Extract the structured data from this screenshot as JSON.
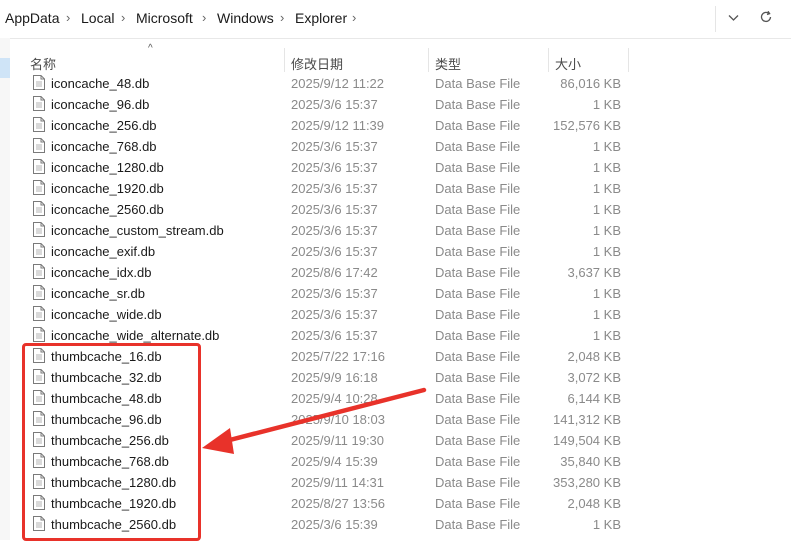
{
  "breadcrumb": [
    "AppData",
    "Local",
    "Microsoft",
    "Windows",
    "Explorer"
  ],
  "address_buttons": {
    "expand_icon": "chevron-down-icon",
    "refresh_icon": "refresh-icon"
  },
  "columns": {
    "name": "名称",
    "date": "修改日期",
    "type": "类型",
    "size": "大小"
  },
  "sort_indicator": "^",
  "files": [
    {
      "name": "iconcache_48.db",
      "date": "2025/9/12 11:22",
      "type": "Data Base File",
      "size": "86,016 KB"
    },
    {
      "name": "iconcache_96.db",
      "date": "2025/3/6 15:37",
      "type": "Data Base File",
      "size": "1 KB"
    },
    {
      "name": "iconcache_256.db",
      "date": "2025/9/12 11:39",
      "type": "Data Base File",
      "size": "152,576 KB"
    },
    {
      "name": "iconcache_768.db",
      "date": "2025/3/6 15:37",
      "type": "Data Base File",
      "size": "1 KB"
    },
    {
      "name": "iconcache_1280.db",
      "date": "2025/3/6 15:37",
      "type": "Data Base File",
      "size": "1 KB"
    },
    {
      "name": "iconcache_1920.db",
      "date": "2025/3/6 15:37",
      "type": "Data Base File",
      "size": "1 KB"
    },
    {
      "name": "iconcache_2560.db",
      "date": "2025/3/6 15:37",
      "type": "Data Base File",
      "size": "1 KB"
    },
    {
      "name": "iconcache_custom_stream.db",
      "date": "2025/3/6 15:37",
      "type": "Data Base File",
      "size": "1 KB"
    },
    {
      "name": "iconcache_exif.db",
      "date": "2025/3/6 15:37",
      "type": "Data Base File",
      "size": "1 KB"
    },
    {
      "name": "iconcache_idx.db",
      "date": "2025/8/6 17:42",
      "type": "Data Base File",
      "size": "3,637 KB"
    },
    {
      "name": "iconcache_sr.db",
      "date": "2025/3/6 15:37",
      "type": "Data Base File",
      "size": "1 KB"
    },
    {
      "name": "iconcache_wide.db",
      "date": "2025/3/6 15:37",
      "type": "Data Base File",
      "size": "1 KB"
    },
    {
      "name": "iconcache_wide_alternate.db",
      "date": "2025/3/6 15:37",
      "type": "Data Base File",
      "size": "1 KB"
    },
    {
      "name": "thumbcache_16.db",
      "date": "2025/7/22 17:16",
      "type": "Data Base File",
      "size": "2,048 KB"
    },
    {
      "name": "thumbcache_32.db",
      "date": "2025/9/9 16:18",
      "type": "Data Base File",
      "size": "3,072 KB"
    },
    {
      "name": "thumbcache_48.db",
      "date": "2025/9/4 10:28",
      "type": "Data Base File",
      "size": "6,144 KB"
    },
    {
      "name": "thumbcache_96.db",
      "date": "2025/9/10 18:03",
      "type": "Data Base File",
      "size": "141,312 KB"
    },
    {
      "name": "thumbcache_256.db",
      "date": "2025/9/11 19:30",
      "type": "Data Base File",
      "size": "149,504 KB"
    },
    {
      "name": "thumbcache_768.db",
      "date": "2025/9/4 15:39",
      "type": "Data Base File",
      "size": "35,840 KB"
    },
    {
      "name": "thumbcache_1280.db",
      "date": "2025/9/11 14:31",
      "type": "Data Base File",
      "size": "353,280 KB"
    },
    {
      "name": "thumbcache_1920.db",
      "date": "2025/8/27 13:56",
      "type": "Data Base File",
      "size": "2,048 KB"
    },
    {
      "name": "thumbcache_2560.db",
      "date": "2025/3/6 15:39",
      "type": "Data Base File",
      "size": "1 KB"
    }
  ],
  "annotation": {
    "color": "#e8322a",
    "highlight": "thumbcache files",
    "arrow": "red-arrow"
  },
  "colors": {
    "text": "#1a1a1a",
    "muted": "#8a8a8a",
    "header": "#4a4a4a",
    "annotation": "#e8322a"
  }
}
